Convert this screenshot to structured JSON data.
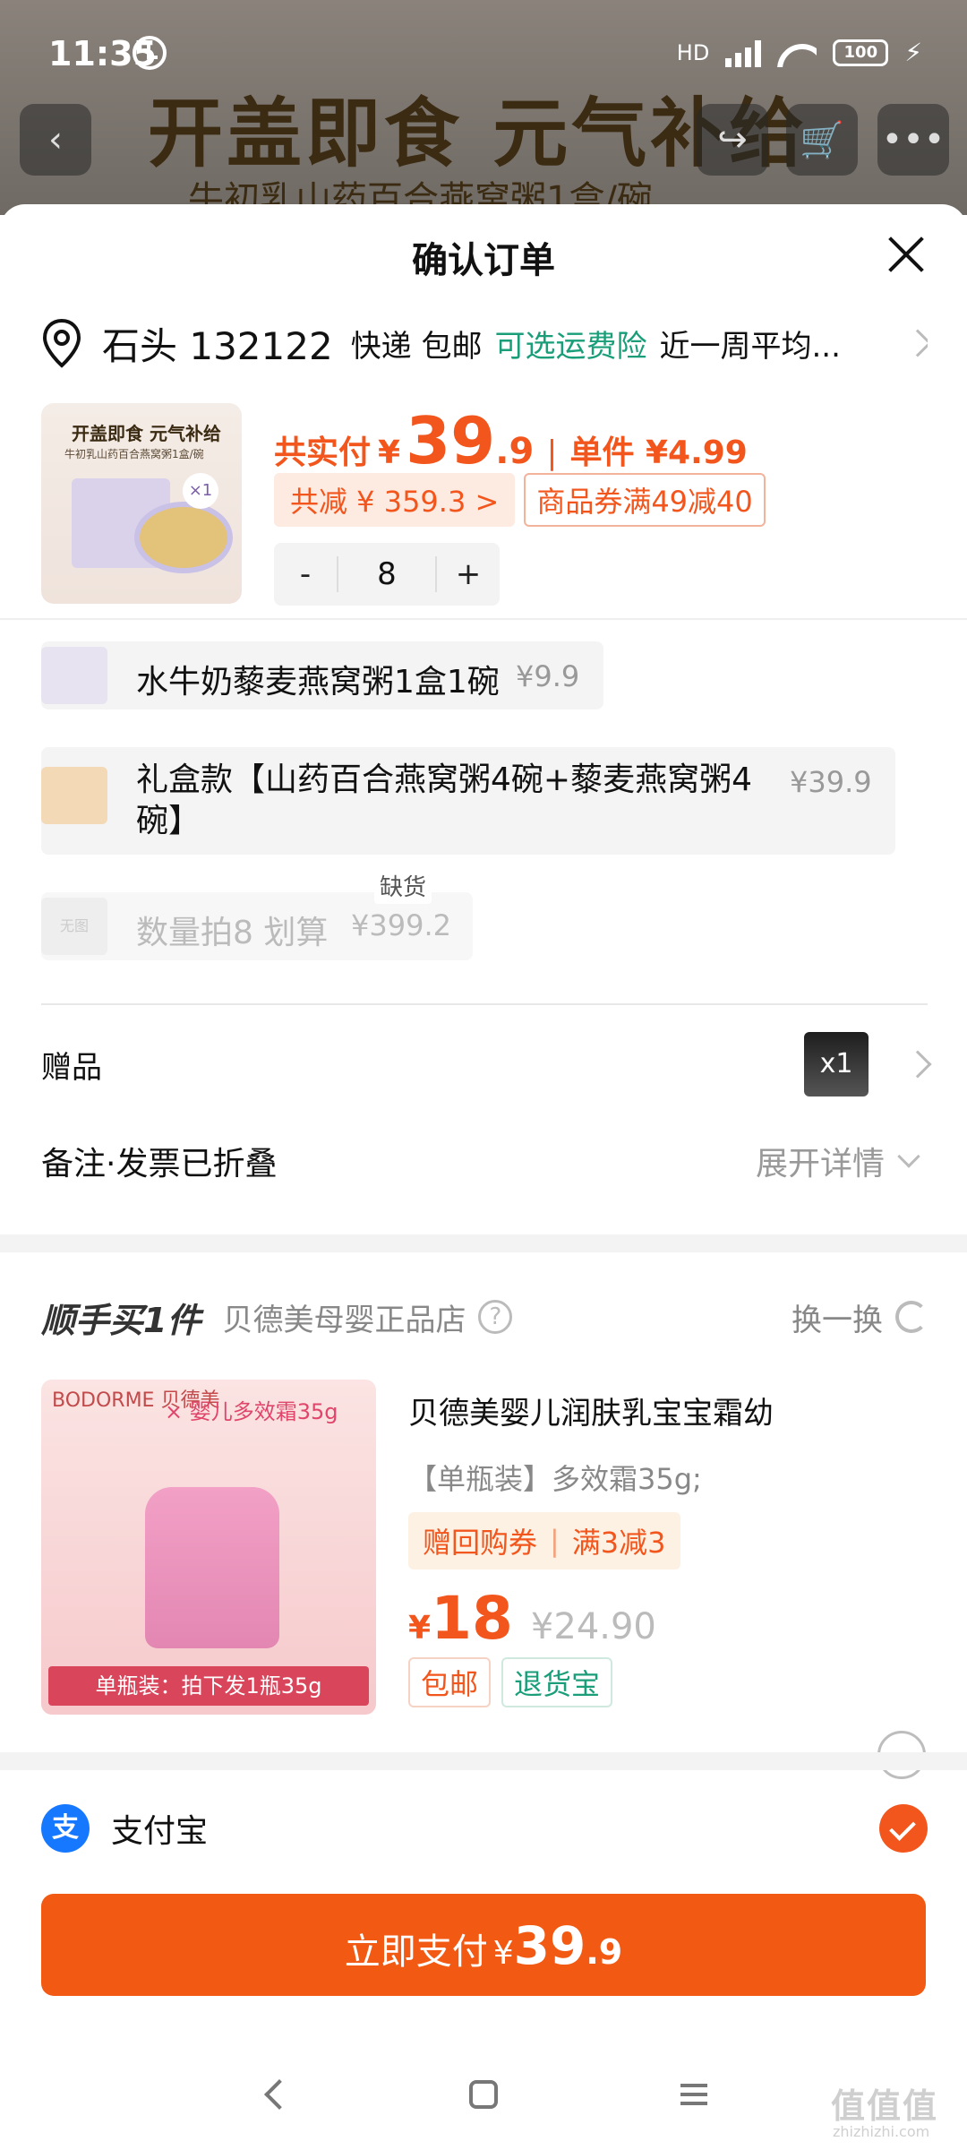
{
  "status_bar": {
    "time": "11:35",
    "network": "HD",
    "battery": "100"
  },
  "background_page": {
    "title": "开盖即食 元气补给",
    "subtitle": "牛初乳山药百合燕窝粥1盒/碗"
  },
  "sheet": {
    "title": "确认订单"
  },
  "address": {
    "name": "石头 132122",
    "shipping": "快递 包邮",
    "insurance": "可选运费险",
    "average": "近一周平均..."
  },
  "product": {
    "image_title": "开盖即食 元气补给",
    "image_subtitle": "牛初乳山药百合燕窝粥1盒/碗",
    "image_badge": "×1",
    "pay_label": "共实付",
    "yen": "¥",
    "pay_int": "39",
    "pay_dec": ".9",
    "unit_label": "单件 ¥4.99",
    "discount": "共减 ¥ 359.3 >",
    "coupon": "商品券满49减40",
    "quantity": "8",
    "minus": "-",
    "plus": "+"
  },
  "skus": [
    {
      "name": "水牛奶藜麦燕窝粥1盒1碗",
      "price": "¥9.9"
    },
    {
      "name": "礼盒款【山药百合燕窝粥4碗+藜麦燕窝粥4碗】",
      "price": "¥39.9"
    },
    {
      "name": "数量拍8 划算",
      "price": "¥399.2",
      "thumb": "无图",
      "status": "缺货"
    }
  ],
  "gift": {
    "label": "赠品",
    "count": "x1"
  },
  "note": {
    "label": "备注·发票已折叠",
    "expand": "展开详情"
  },
  "upsell": {
    "title": "顺手买1件",
    "shop": "贝德美母婴正品店",
    "help": "?",
    "swap": "换一换",
    "image_brand": "BODORME 贝德美",
    "image_tag": "× 婴儿多效霜35g",
    "image_band": "单瓶装：拍下发1瓶35g",
    "product_title": "贝德美婴儿润肤乳宝宝霜幼",
    "spec": "【单瓶装】多效霜35g;",
    "promo1": "赠回购券",
    "promo2": "满3减3",
    "yen": "¥",
    "price": "18",
    "original_price": "¥24.90",
    "tag1": "包邮",
    "tag2": "退货宝"
  },
  "payment": {
    "alipay_icon": "支",
    "method": "支付宝",
    "button_label": "立即支付",
    "button_yen": "¥",
    "button_int": "39",
    "button_dec": ".9"
  },
  "watermark": {
    "text": "值值值",
    "sub": "zhizhizhi.com"
  },
  "colors": {
    "accent": "#f25a13",
    "green": "#1a9e7a",
    "alipay": "#1677ff"
  }
}
